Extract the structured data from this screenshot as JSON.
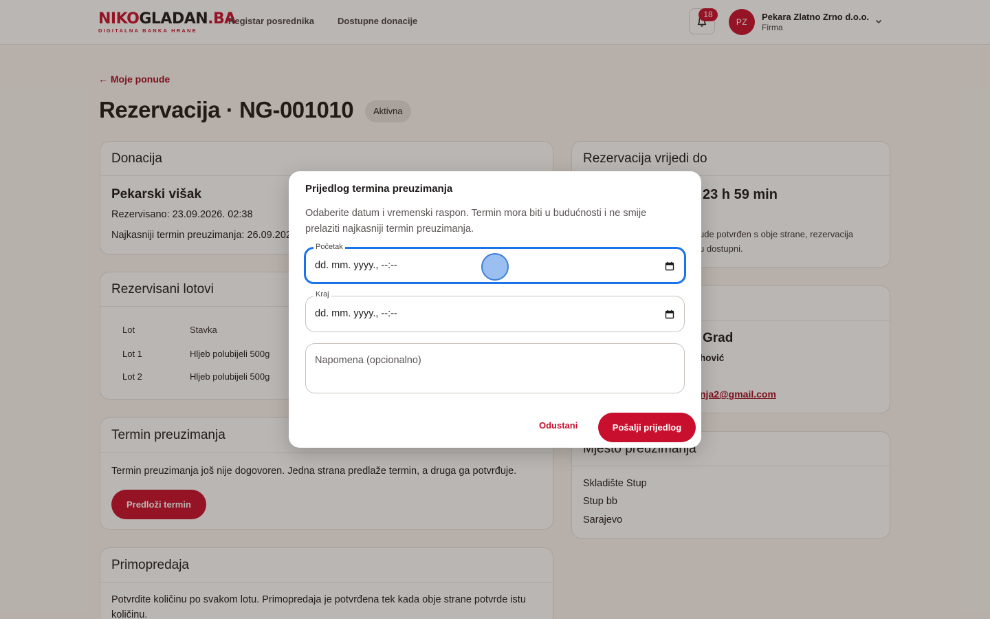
{
  "header": {
    "logo_part1": "NIKO",
    "logo_part2": "GLADAN",
    "logo_part3": ".BA",
    "logo_subtitle": "DIGITALNA BANKA HRANE",
    "nav": [
      "Registar posrednika",
      "Dostupne donacije"
    ],
    "notifications_count": "18",
    "avatar_initials": "PZ",
    "user_name": "Pekara Zlatno Zrno d.o.o.",
    "user_role": "Firma"
  },
  "page": {
    "back_link": "← Moje ponude",
    "title": "Rezervacija · NG-001010",
    "status": "Aktivna"
  },
  "donation": {
    "title": "Donacija",
    "name": "Pekarski višak",
    "reserved": "Rezervisano: 23.09.2026. 02:38",
    "deadline": "Najkasniji termin preuzimanja: 26.09.2026"
  },
  "lots": {
    "title": "Rezervisani lotovi",
    "columns": [
      "Lot",
      "Stavka"
    ],
    "rows": [
      {
        "lot": "Lot 1",
        "item": "Hljeb polubijeli 500g"
      },
      {
        "lot": "Lot 2",
        "item": "Hljeb polubijeli 500g"
      }
    ]
  },
  "pickup_term": {
    "title": "Termin preuzimanja",
    "text": "Termin preuzimanja još nije dogovoren. Jedna strana predlaže termin, a druga ga potvrđuje.",
    "button": "Predloži termin"
  },
  "handover": {
    "title": "Primopredaja",
    "text_line1": "Potvrdite količinu po svakom lotu. Primopredaja je potvrđena tek kada obje strane potvrde istu",
    "text_line2": "količinu."
  },
  "valid_until": {
    "title": "Rezervacija vrijedi do",
    "countdown": "23 h 59 min",
    "text_line1": "ude potvrđen s obje strane, rezervacija",
    "text_line2": "u dostupni."
  },
  "organization": {
    "name": "Grad",
    "contact": "hović",
    "email": "nja2@gmail.com"
  },
  "pickup_place": {
    "title": "Mjesto preuzimanja",
    "lines": [
      "Skladište Stup",
      "Stup bb",
      "Sarajevo"
    ]
  },
  "modal": {
    "title": "Prijedlog termina preuzimanja",
    "description": "Odaberite datum i vremenski raspon. Termin mora biti u budućnosti i ne smije prelaziti najkasniji termin preuzimanja.",
    "start_label": "Početak",
    "start_value": "dd. mm. yyyy., --:--",
    "end_label": "Kraj",
    "end_value": "dd. mm. yyyy., --:--",
    "note_placeholder": "Napomena (opcionalno)",
    "cancel": "Odustani",
    "submit": "Pošalji prijedlog"
  },
  "colors": {
    "brand": "#c8102e",
    "focus": "#1a73e8",
    "background": "#fbf7f2"
  }
}
